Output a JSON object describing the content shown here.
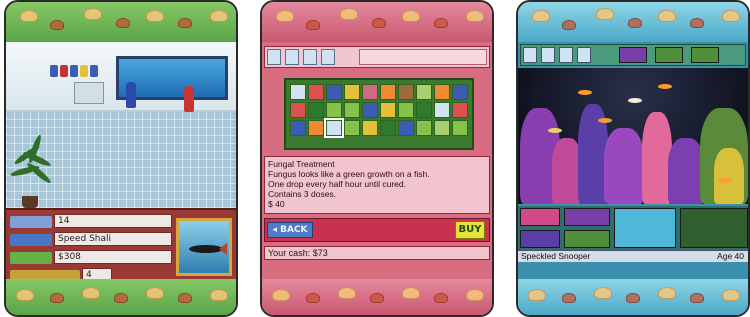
{
  "store_screen": {
    "fields": [
      {
        "label_color": "#7fa0d8",
        "value": "14"
      },
      {
        "label_color": "#4a78c4",
        "value": "Speed Shali"
      },
      {
        "label_color": "#67b04a",
        "value": "$308"
      },
      {
        "label_color": "#c7a13a",
        "value": "4"
      }
    ]
  },
  "items_screen": {
    "description_lines": [
      "Fungal Treatment",
      "Fungus looks like a green growth on a fish.",
      "One drop every half hour until cured.",
      "Contains 3 doses.",
      "$ 40"
    ],
    "back_label": "◂ BACK",
    "buy_label": "BUY",
    "cash_label": "Your cash: $73"
  },
  "aquarium_screen": {
    "fish_name": "Speckled Snooper",
    "age_label": "Age 40"
  },
  "colors": {
    "band_green": "#6fb858",
    "band_pink": "#d06a80",
    "band_blue": "#6cc2dc",
    "panel_red": "#9a3a34"
  }
}
